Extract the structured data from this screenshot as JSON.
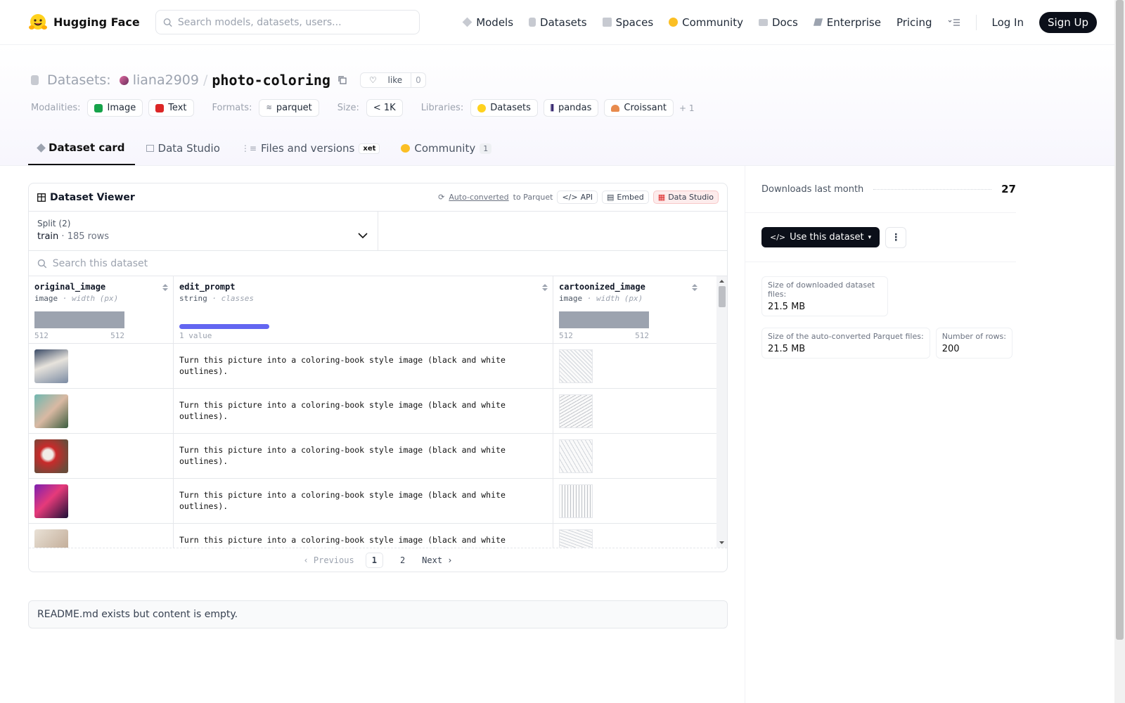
{
  "nav": {
    "brand": "Hugging Face",
    "search_placeholder": "Search models, datasets, users...",
    "links": [
      "Models",
      "Datasets",
      "Spaces",
      "Community",
      "Docs",
      "Enterprise",
      "Pricing"
    ],
    "login": "Log In",
    "signup": "Sign Up"
  },
  "header": {
    "section": "Datasets:",
    "owner": "liana2909",
    "separator": "/",
    "repo": "photo-coloring",
    "like_label": "like",
    "like_count": "0",
    "modalities_label": "Modalities:",
    "modalities": [
      "Image",
      "Text"
    ],
    "formats_label": "Formats:",
    "formats": [
      "parquet"
    ],
    "size_label": "Size:",
    "size": "< 1K",
    "libraries_label": "Libraries:",
    "libraries": [
      "Datasets",
      "pandas",
      "Croissant"
    ],
    "libraries_more": "+ 1",
    "tabs": {
      "card": "Dataset card",
      "studio": "Data Studio",
      "files": "Files and versions",
      "files_badge": "xet",
      "community": "Community",
      "community_count": "1"
    }
  },
  "viewer": {
    "title": "Dataset Viewer",
    "auto_converted": "Auto-converted",
    "to_parquet": "to Parquet",
    "api": "API",
    "embed": "Embed",
    "data_studio": "Data Studio",
    "split_label": "Split (2)",
    "split_value": "train",
    "split_dot": "·",
    "split_rows": "185 rows",
    "search_placeholder": "Search this dataset",
    "columns": [
      {
        "name": "original_image",
        "type": "image",
        "sub": "width (px)",
        "min": "512",
        "max": "512"
      },
      {
        "name": "edit_prompt",
        "type": "string",
        "sub": "classes",
        "stat": "1 value"
      },
      {
        "name": "cartoonized_image",
        "type": "image",
        "sub": "width (px)",
        "min": "512",
        "max": "512"
      }
    ],
    "type_sep": " · ",
    "rows": [
      {
        "prompt": "Turn this picture into a coloring-book style image (black and white outlines)."
      },
      {
        "prompt": "Turn this picture into a coloring-book style image (black and white outlines)."
      },
      {
        "prompt": "Turn this picture into a coloring-book style image (black and white outlines)."
      },
      {
        "prompt": "Turn this picture into a coloring-book style image (black and white outlines)."
      },
      {
        "prompt": "Turn this picture into a coloring-book style image (black and white outlines)."
      }
    ],
    "pager": {
      "prev": "Previous",
      "page1": "1",
      "page2": "2",
      "next": "Next"
    }
  },
  "readme": "README.md exists but content is empty.",
  "sidebar": {
    "downloads_label": "Downloads last month",
    "downloads": "27",
    "use_button": "Use this dataset",
    "stats": [
      {
        "label": "Size of downloaded dataset files:",
        "value": "21.5 MB"
      },
      {
        "label": "Size of the auto-converted Parquet files:",
        "value": "21.5 MB"
      },
      {
        "label": "Number of rows:",
        "value": "200"
      }
    ]
  },
  "colors": {
    "accent_dark": "#0b0f19",
    "histogram": "#9ca3af",
    "classes_bar": "#6366f1",
    "data_studio_red": "#fdecec"
  }
}
